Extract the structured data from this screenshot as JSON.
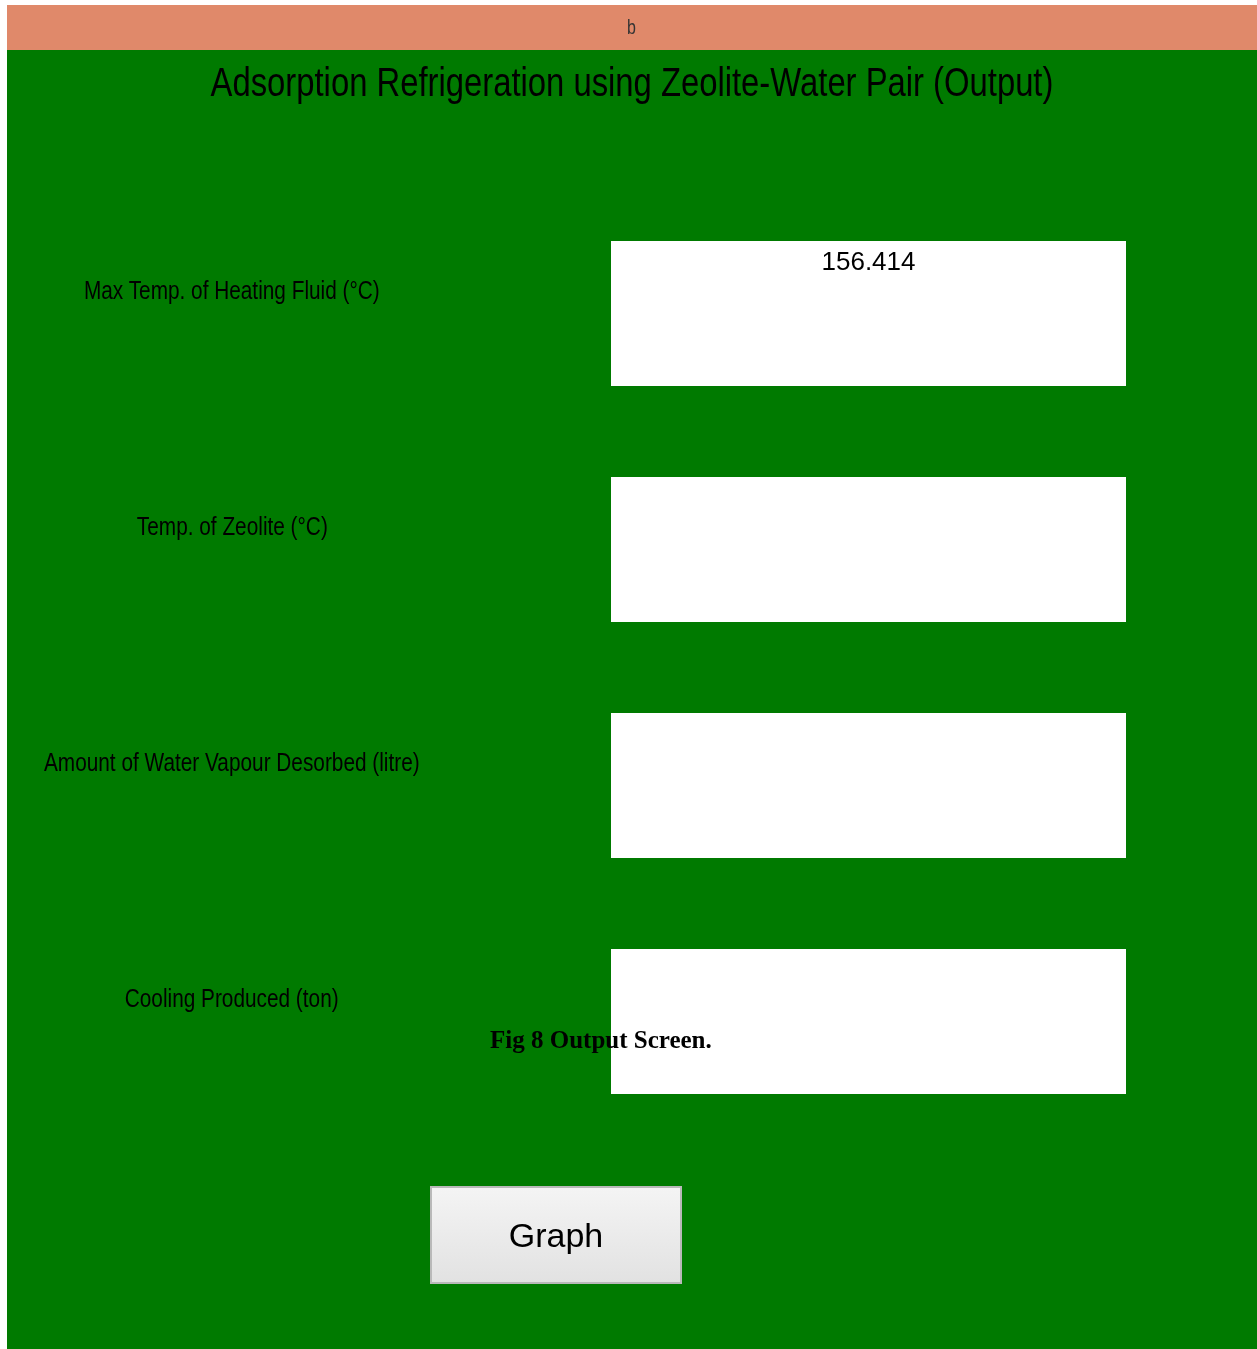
{
  "window": {
    "title": "b"
  },
  "heading": "Adsorption Refrigeration using Zeolite-Water Pair (Output)",
  "outputs": [
    {
      "label": "Max Temp. of Heating Fluid  (°C)",
      "value": "156.414"
    },
    {
      "label": "Temp. of Zeolite  (°C)"
    },
    {
      "label": "Amount of Water Vapour Desorbed (litre)"
    },
    {
      "label": "Cooling Produced (ton)"
    }
  ],
  "buttons": [
    "Graph"
  ],
  "caption": "Fig 8 Output Screen."
}
